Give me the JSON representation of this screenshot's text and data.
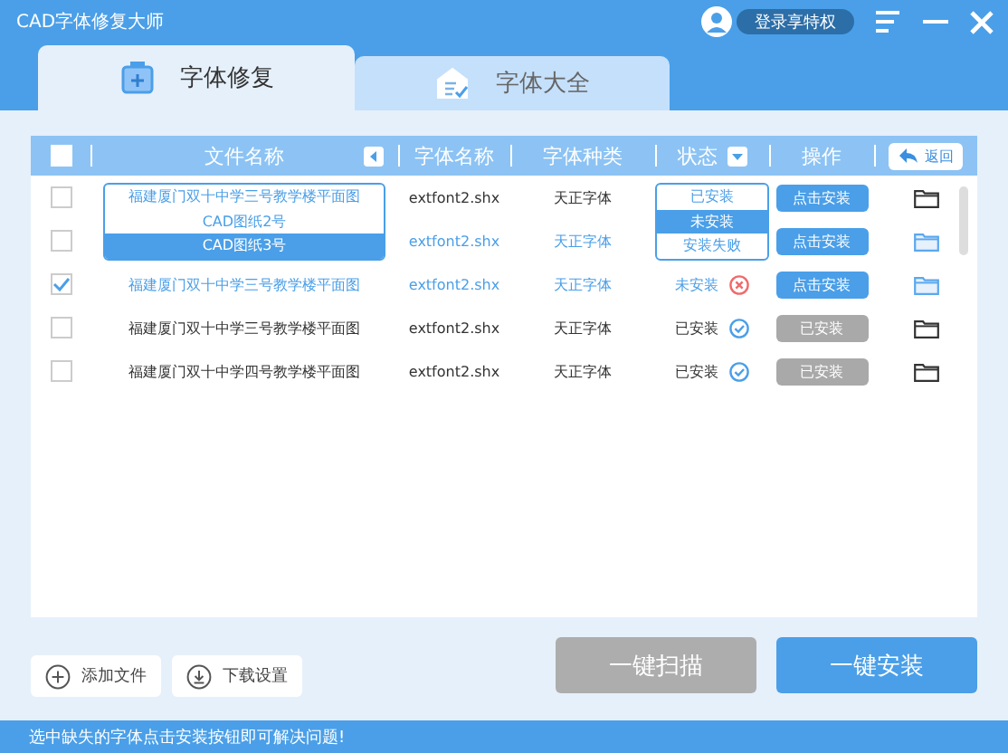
{
  "window": {
    "title": "CAD字体修复大师",
    "login": "登录享特权"
  },
  "tabs": [
    {
      "label": "字体修复",
      "selected": true
    },
    {
      "label": "字体大全",
      "selected": false
    }
  ],
  "table": {
    "header_checked": false,
    "columns": [
      "文件名称",
      "字体名称",
      "字体种类",
      "状态",
      "操作"
    ],
    "back": "返回",
    "rows": [
      {
        "checked": false,
        "highlight": false,
        "font": "extfont2.shx",
        "type": "天正字体",
        "action": "点击安装",
        "action_disabled": false
      },
      {
        "checked": false,
        "highlight": true,
        "font": "extfont2.shx",
        "type": "天正字体",
        "action": "点击安装",
        "action_disabled": false
      },
      {
        "checked": true,
        "highlight": true,
        "file": "福建厦门双十中学三号教学楼平面图",
        "font": "extfont2.shx",
        "type": "天正字体",
        "status": "未安装",
        "kind": "missing",
        "action": "点击安装",
        "action_disabled": false
      },
      {
        "checked": false,
        "highlight": false,
        "file": "福建厦门双十中学三号教学楼平面图",
        "font": "extfont2.shx",
        "type": "天正字体",
        "status": "已安装",
        "kind": "installed",
        "action": "已安装",
        "action_disabled": true
      },
      {
        "checked": false,
        "highlight": false,
        "file": "福建厦门双十中学四号教学楼平面图",
        "font": "extfont2.shx",
        "type": "天正字体",
        "status": "已安装",
        "kind": "installed",
        "action": "已安装",
        "action_disabled": true
      }
    ],
    "file_dropdown": [
      {
        "label": "福建厦门双十中学三号教学楼平面图",
        "selected": false
      },
      {
        "label": "CAD图纸2号",
        "selected": false
      },
      {
        "label": "CAD图纸3号",
        "selected": true
      }
    ],
    "status_dropdown": [
      {
        "label": "已安装",
        "selected": false
      },
      {
        "label": "未安装",
        "selected": true
      },
      {
        "label": "安装失败",
        "selected": false
      }
    ]
  },
  "bottom": {
    "add_file": "添加文件",
    "download_settings": "下载设置",
    "scan": "一键扫描",
    "scan_disabled": true,
    "install": "一键安装"
  },
  "status_bar": "选中缺失的字体点击安装按钮即可解决问题!"
}
